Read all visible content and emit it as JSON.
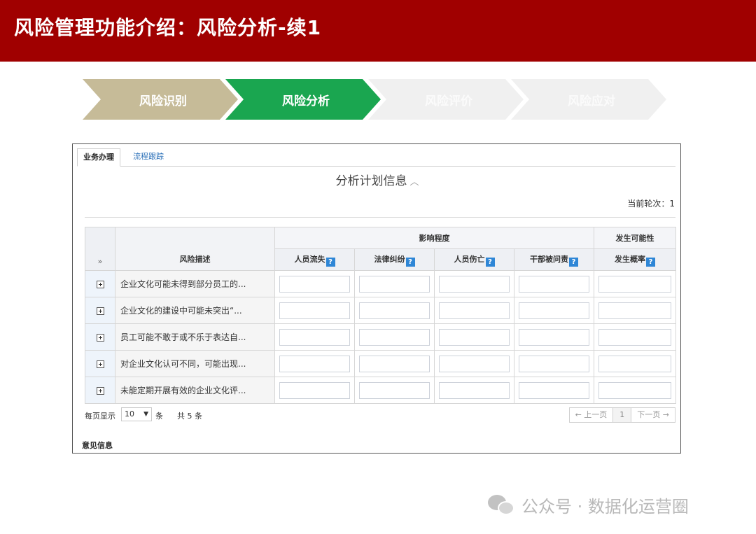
{
  "banner": {
    "title": "风险管理功能介绍：风险分析-续1"
  },
  "steps": [
    {
      "label": "风险识别",
      "state": "done",
      "color": "#c6bb98"
    },
    {
      "label": "风险分析",
      "state": "active",
      "color": "#1aa650"
    },
    {
      "label": "风险评价",
      "state": "pending",
      "color": "#f0f0f0"
    },
    {
      "label": "风险应对",
      "state": "pending",
      "color": "#f0f0f0"
    }
  ],
  "tabs": [
    {
      "label": "业务办理",
      "active": true
    },
    {
      "label": "流程跟踪",
      "active": false
    }
  ],
  "section": {
    "title": "分析计划信息",
    "collapse_icon": "chevron-up-icon",
    "round_label": "当前轮次：1"
  },
  "table": {
    "group_headers": {
      "impact": "影响程度",
      "likelihood": "发生可能性"
    },
    "toggle_header": "»",
    "desc_header": "风险描述",
    "columns": [
      "人员流失",
      "法律纠纷",
      "人员伤亡",
      "干部被问责",
      "发生概率"
    ],
    "help_glyph": "?",
    "rows": [
      {
        "description": "企业文化可能未得到部分员工的..."
      },
      {
        "description": "企业文化的建设中可能未突出“..."
      },
      {
        "description": "员工可能不敢于或不乐于表达自..."
      },
      {
        "description": "对企业文化认可不同，可能出现..."
      },
      {
        "description": "未能定期开展有效的企业文化评..."
      }
    ]
  },
  "pager": {
    "per_page_label": "每页显示",
    "page_size": "10",
    "unit": "条",
    "total": "共 5 条",
    "prev": "← 上一页",
    "current": "1",
    "next": "下一页 →"
  },
  "opinion": {
    "label": "意见信息"
  },
  "footer": {
    "text": "公众号 · 数据化运营圈",
    "icon": "wechat-icon"
  },
  "colors": {
    "banner": "#a00000",
    "active_step": "#1aa650",
    "done_step": "#c6bb98",
    "help_icon": "#2e86d6",
    "link": "#2a6fb8"
  }
}
